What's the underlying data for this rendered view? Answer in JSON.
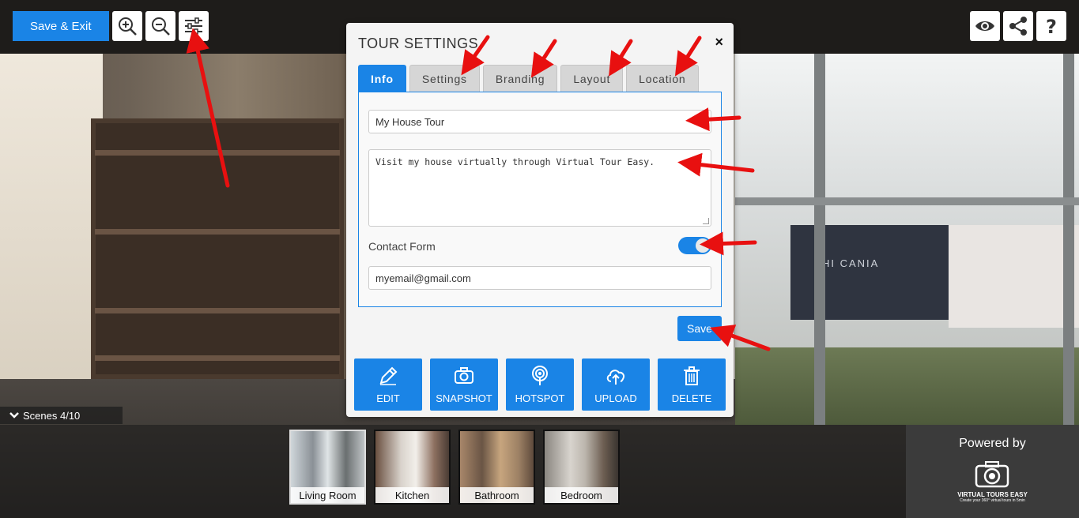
{
  "toolbar": {
    "save_exit_label": "Save & Exit",
    "left_tools": [
      "zoom-in-icon",
      "zoom-out-icon",
      "sliders-icon"
    ],
    "right_tools": [
      "eye-icon",
      "share-icon",
      "help-icon"
    ]
  },
  "dialog": {
    "title": "TOUR SETTINGS",
    "close_label": "×",
    "tabs": [
      {
        "label": "Info",
        "active": true
      },
      {
        "label": "Settings",
        "active": false
      },
      {
        "label": "Branding",
        "active": false
      },
      {
        "label": "Layout",
        "active": false
      },
      {
        "label": "Location",
        "active": false
      }
    ],
    "info": {
      "tour_name": "My House Tour",
      "description": "Visit my house virtually through Virtual Tour Easy.",
      "contact_form_label": "Contact Form",
      "contact_form_enabled": true,
      "email": "myemail@gmail.com"
    },
    "save_label": "Save"
  },
  "actions": [
    {
      "label": "EDIT",
      "icon": "pencil-icon"
    },
    {
      "label": "SNAPSHOT",
      "icon": "camera-icon"
    },
    {
      "label": "HOTSPOT",
      "icon": "hotspot-icon"
    },
    {
      "label": "UPLOAD",
      "icon": "cloud-upload-icon"
    },
    {
      "label": "DELETE",
      "icon": "trash-icon"
    }
  ],
  "scenes": {
    "label": "Scenes 4/10",
    "items": [
      {
        "label": "Living Room",
        "active": true
      },
      {
        "label": "Kitchen",
        "active": false
      },
      {
        "label": "Bathroom",
        "active": false
      },
      {
        "label": "Bedroom",
        "active": false
      }
    ]
  },
  "powered_by": {
    "label": "Powered by",
    "brand": "VIRTUAL TOURS EASY",
    "tagline": "Create your 360° virtual tours in 5min"
  },
  "billboard_text": "HI  CANIA",
  "colors": {
    "accent": "#1a84e6",
    "annotation_arrow": "#e81010"
  }
}
